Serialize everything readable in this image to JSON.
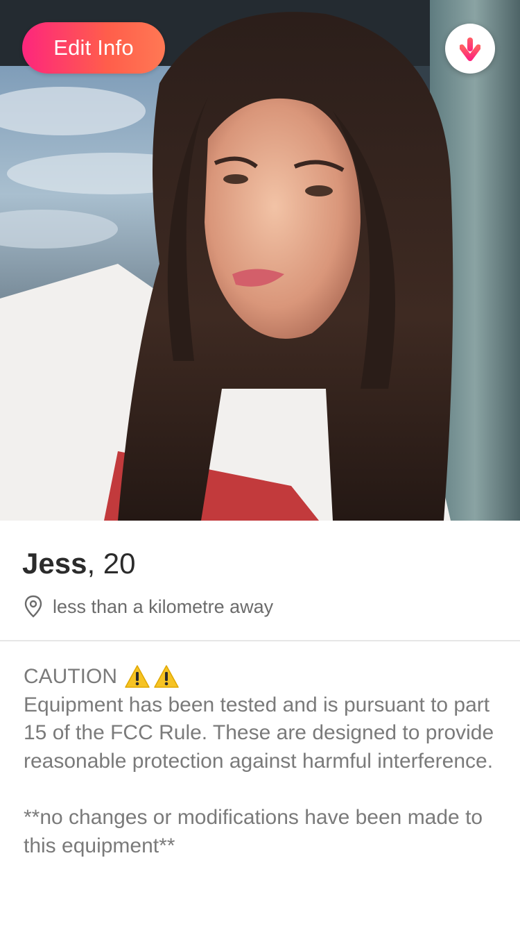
{
  "header": {
    "edit_button_label": "Edit Info",
    "collapse_icon": "arrow-down-icon"
  },
  "profile": {
    "name": "Jess",
    "age_text": ", 20",
    "distance_icon": "location-pin-icon",
    "distance": "less than a kilometre away"
  },
  "bio": {
    "caution_label": "CAUTION",
    "warning_icons": [
      "warning-icon",
      "warning-icon"
    ],
    "paragraph_1": "Equipment has been tested and is pursuant to part 15 of the FCC Rule. These are designed to provide reasonable protection against harmful interference.",
    "paragraph_2": "**no changes or modifications have been made to this equipment**"
  },
  "colors": {
    "brand_gradient_start": "#fd267d",
    "brand_gradient_end": "#ff7854",
    "text_primary": "#2b2b2b",
    "text_secondary": "#7a7a7a",
    "warning_yellow": "#f6c324"
  }
}
